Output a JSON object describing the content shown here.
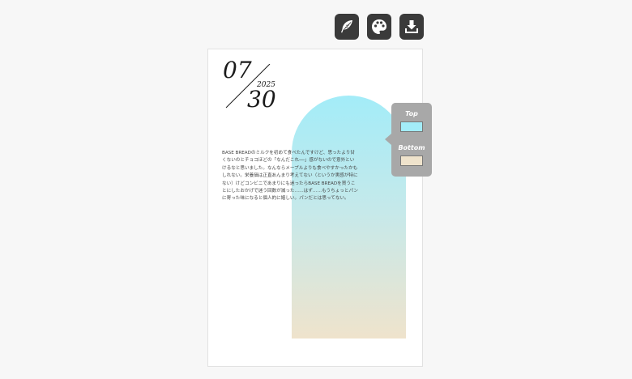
{
  "toolbar": {
    "buttons": [
      {
        "icon": "feather-icon"
      },
      {
        "icon": "palette-icon"
      },
      {
        "icon": "download-icon"
      }
    ]
  },
  "card": {
    "month": "07",
    "day": "30",
    "year": "2025",
    "body": "BASE BREADのミルクを初めて食べたんですけど、思ったより甘くないのとチョコほどの「なんだこれ──」感がないので意外といけるなと思いました。なんならメープルよりも食べやすかったかもしれない。栄養価は正直あんまり考えてない（というか実感が特にない）けどコンビニであまりにも迷ったらBASE BREADを買うことにしたおかげで迷う回数が減った……はず……もうちょっとパンに寄った味になると個人的に嬉しい。パンだとは思ってない。"
  },
  "picker": {
    "top_label": "Top",
    "bottom_label": "Bottom",
    "top_color": "#a3ecf8",
    "bottom_color": "#efe3cc"
  }
}
